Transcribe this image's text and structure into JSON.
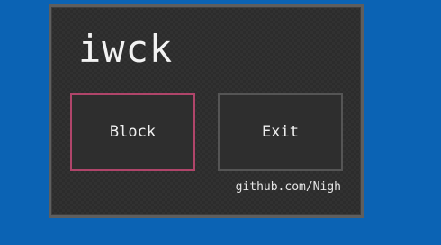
{
  "window": {
    "title": "iwck"
  },
  "buttons": {
    "block_label": "Block",
    "exit_label": "Exit"
  },
  "footer": {
    "link_text": "github.com/Nigh"
  },
  "colors": {
    "desktop_background": "#0b63b4",
    "window_background": "#2c2c2c",
    "window_border": "#5e5e5e",
    "focused_button_border": "#b0456a",
    "button_border": "#555555",
    "text": "#f0f0f0"
  }
}
